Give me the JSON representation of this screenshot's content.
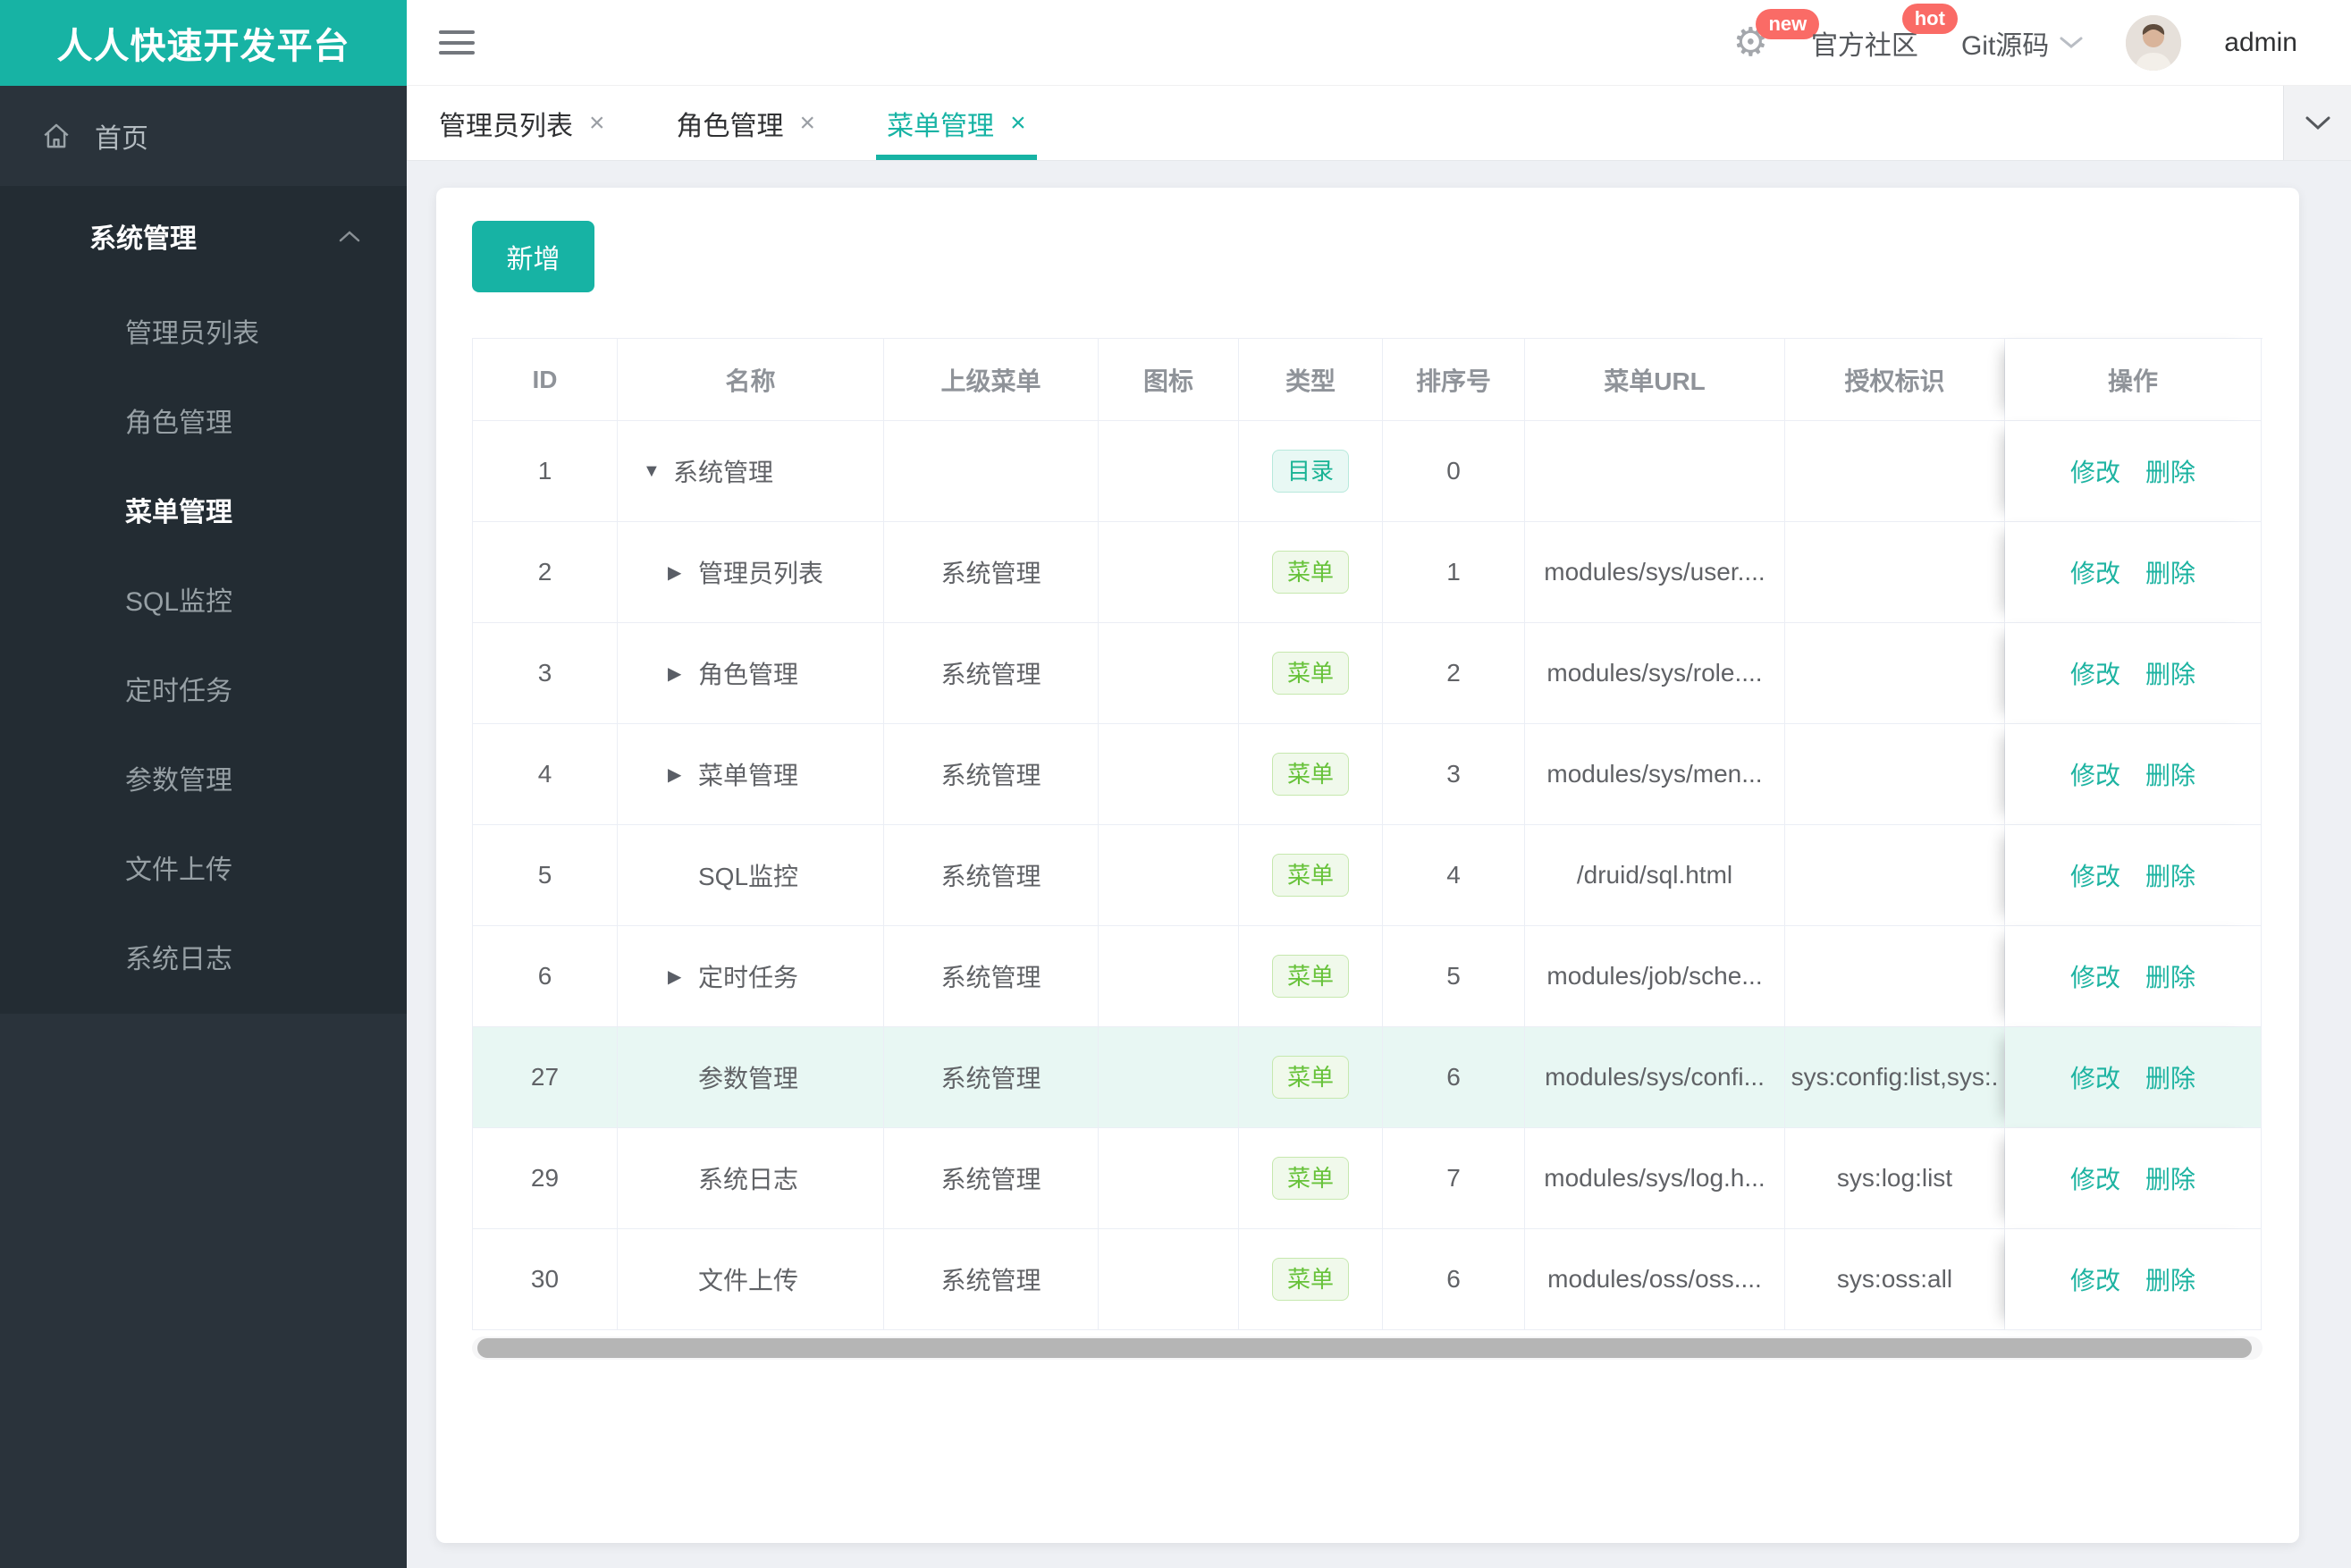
{
  "brand": {
    "title": "人人快速开发平台",
    "accent_color": "#17b3a4"
  },
  "header": {
    "badge_new": "new",
    "badge_hot": "hot",
    "badge_color": "#fa6b66",
    "community_label": "官方社区",
    "git_label": "Git源码",
    "user_label": "admin"
  },
  "sidebar": {
    "home_label": "首页",
    "group_label": "系统管理",
    "items": [
      "管理员列表",
      "角色管理",
      "菜单管理",
      "SQL监控",
      "定时任务",
      "参数管理",
      "文件上传",
      "系统日志"
    ],
    "active": "菜单管理"
  },
  "tabs": {
    "labels": [
      "管理员列表",
      "角色管理",
      "菜单管理"
    ],
    "active_index": 2,
    "close_glyph": "×"
  },
  "toolbar": {
    "add_label": "新增"
  },
  "table": {
    "columns": [
      "ID",
      "名称",
      "上级菜单",
      "图标",
      "类型",
      "排序号",
      "菜单URL",
      "授权标识",
      "操作"
    ],
    "actions": {
      "edit": "修改",
      "delete": "删除"
    },
    "badge_colors": {
      "dir": "#19b394",
      "menu": "#67c23a"
    },
    "highlight_color": "#e8f7f3",
    "rows": [
      {
        "id": "1",
        "arrow": "down",
        "name": "系统管理",
        "parent": "",
        "type": "目录",
        "kind": "dir",
        "order": "0",
        "url": "",
        "perm": "",
        "highlight": false
      },
      {
        "id": "2",
        "arrow": "right",
        "name": "管理员列表",
        "parent": "系统管理",
        "type": "菜单",
        "kind": "menu",
        "order": "1",
        "url": "modules/sys/user....",
        "perm": "",
        "highlight": false
      },
      {
        "id": "3",
        "arrow": "right",
        "name": "角色管理",
        "parent": "系统管理",
        "type": "菜单",
        "kind": "menu",
        "order": "2",
        "url": "modules/sys/role....",
        "perm": "",
        "highlight": false
      },
      {
        "id": "4",
        "arrow": "right",
        "name": "菜单管理",
        "parent": "系统管理",
        "type": "菜单",
        "kind": "menu",
        "order": "3",
        "url": "modules/sys/men...",
        "perm": "",
        "highlight": false
      },
      {
        "id": "5",
        "arrow": "none",
        "name": "SQL监控",
        "parent": "系统管理",
        "type": "菜单",
        "kind": "menu",
        "order": "4",
        "url": "/druid/sql.html",
        "perm": "",
        "highlight": false
      },
      {
        "id": "6",
        "arrow": "right",
        "name": "定时任务",
        "parent": "系统管理",
        "type": "菜单",
        "kind": "menu",
        "order": "5",
        "url": "modules/job/sche...",
        "perm": "",
        "highlight": false
      },
      {
        "id": "27",
        "arrow": "none",
        "name": "参数管理",
        "parent": "系统管理",
        "type": "菜单",
        "kind": "menu",
        "order": "6",
        "url": "modules/sys/confi...",
        "perm": "sys:config:list,sys:.",
        "highlight": true
      },
      {
        "id": "29",
        "arrow": "none",
        "name": "系统日志",
        "parent": "系统管理",
        "type": "菜单",
        "kind": "menu",
        "order": "7",
        "url": "modules/sys/log.h...",
        "perm": "sys:log:list",
        "highlight": false
      },
      {
        "id": "30",
        "arrow": "none",
        "name": "文件上传",
        "parent": "系统管理",
        "type": "菜单",
        "kind": "menu",
        "order": "6",
        "url": "modules/oss/oss....",
        "perm": "sys:oss:all",
        "highlight": false
      }
    ]
  }
}
